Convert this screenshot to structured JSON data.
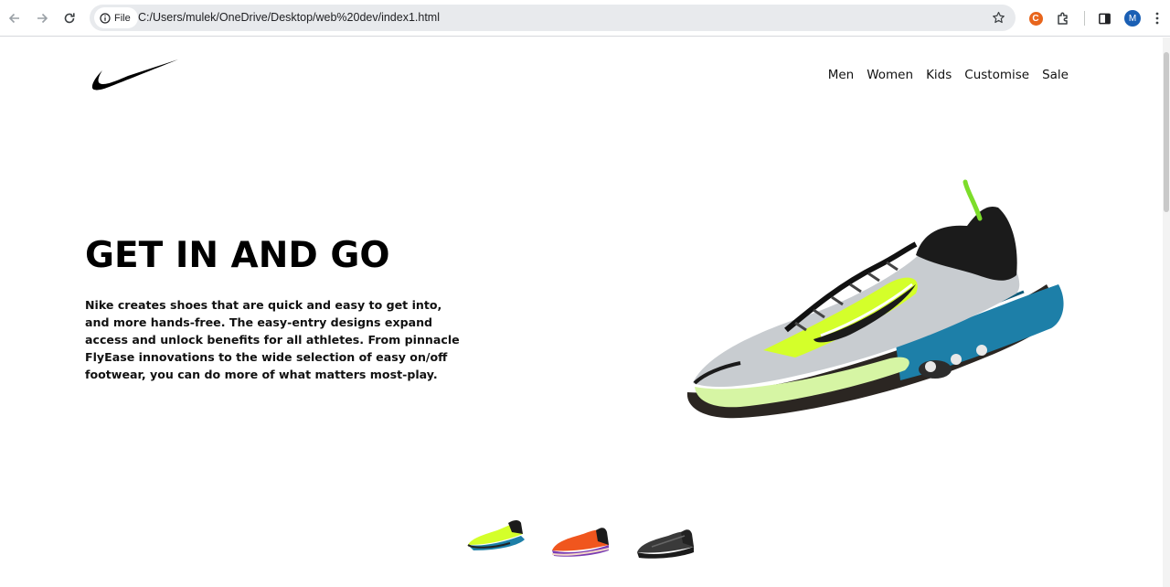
{
  "browser": {
    "chip_label": "File",
    "url": "C:/Users/mulek/OneDrive/Desktop/web%20dev/index1.html",
    "extension_letter": "C",
    "profile_initial": "M"
  },
  "nav": {
    "items": [
      {
        "label": "Men"
      },
      {
        "label": "Women"
      },
      {
        "label": "Kids"
      },
      {
        "label": "Customise"
      },
      {
        "label": "Sale"
      }
    ]
  },
  "hero": {
    "title": "GET IN AND GO",
    "description": "Nike creates shoes that are quick and easy to get into, and more hands-free. The easy-entry designs expand access and unlock benefits for all athletes. From pinnacle FlyEase innovations to the wide selection of easy on/off footwear, you can do more of what matters most-play."
  },
  "colors": {
    "accent_volt": "#d4ff2a",
    "shoe_blue": "#1d7fa8",
    "shoe_orange": "#f0561e",
    "shoe_purple": "#7a3db3",
    "shoe_grey": "#3a3a3a"
  },
  "thumbnails": [
    {
      "name": "volt-blue-shoe"
    },
    {
      "name": "orange-purple-shoe"
    },
    {
      "name": "black-grey-shoe"
    }
  ]
}
